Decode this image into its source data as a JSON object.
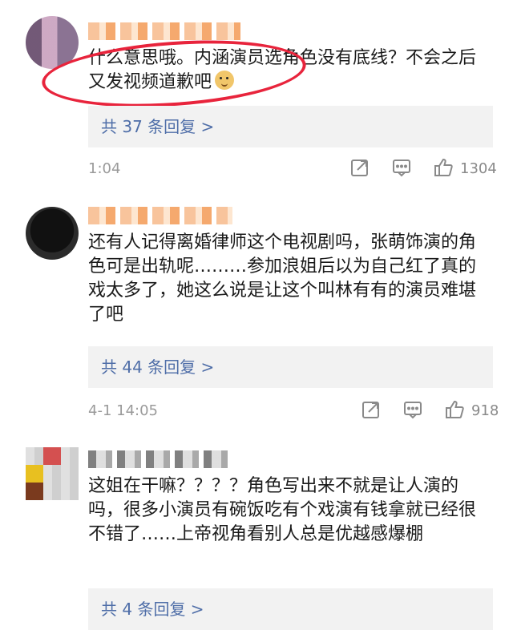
{
  "comments": [
    {
      "text": "什么意思哦。内涵演员选角色没有底线？不会之后又发视频道歉吧",
      "replies_label": "共 37 条回复 >",
      "time": "1:04",
      "likes": "1304"
    },
    {
      "text": "还有人记得离婚律师这个电视剧吗，张萌饰演的角色可是出轨呢………参加浪姐后以为自己红了真的戏太多了，她这么说是让这个叫林有有的演员难堪了吧",
      "replies_label": "共 44 条回复 >",
      "time": "4-1 14:05",
      "likes": "918"
    },
    {
      "text": "这姐在干嘛？？？？角色写出来不就是让人演的吗，很多小演员有碗饭吃有个戏演有钱拿就已经很不错了……上帝视角看别人总是优越感爆棚",
      "replies_label": "共 4 条回复 >"
    }
  ],
  "colors": {
    "link": "#4f6ea8",
    "annotation": "#e8243c"
  },
  "icons": [
    "share-icon",
    "comment-icon",
    "like-icon",
    "laughing-doge-emoji"
  ]
}
